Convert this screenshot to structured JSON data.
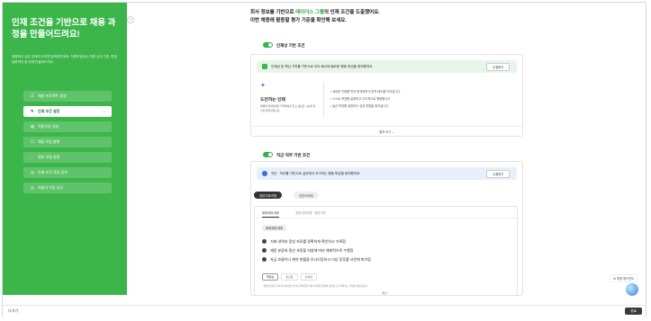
{
  "sidebar": {
    "title": "인재 조건을 기반으로 채용 과정을 만들어드려요!",
    "description": "채용하고 싶은 인재의 조건만 정의해주세요. 직원모집이나 지원 심사 기준, 면접 질문까지 한 번에 만들어드려요.",
    "collapse_label": "‹",
    "items": [
      {
        "label": "채용 프로젝트 생성",
        "icon": "☰"
      },
      {
        "label": "인재 조건 설정",
        "icon": "✎",
        "more": "···"
      },
      {
        "label": "직원모집 생성",
        "icon": "▤"
      },
      {
        "label": "채용 모집 발행",
        "icon": "☐"
      },
      {
        "label": "정보 모집 설정",
        "icon": "◌"
      },
      {
        "label": "인재 조건 작동 검사",
        "icon": "◎"
      },
      {
        "label": "지원서 작동 검사",
        "icon": "◎"
      }
    ]
  },
  "main": {
    "headline_pre": "회사 정보를 기반으로 ",
    "headline_highlight": "레이더스 그룹",
    "headline_post": "의 인재 조건을 도출했어요.",
    "headline_line2": "이번 채용에 활용할 평가 기준을 확인해 보세요.",
    "section1": {
      "label": "인재상 기반 조건",
      "banner_text": "인재상 및 핵심 가치를 기반으로 우리 회사에 필요한 행동 특성을 정의했어요.",
      "banner_button": "수정하기",
      "trait_title": "도전하는 인재",
      "trait_desc": "변화와 불확실성을 두려워하지 않고 새로운 시도와 혁신을 만들어냅니다.",
      "bullets": [
        "새로운 기회를 먼저 탐색하며 도전적 태도를 이어갑니다.",
        "스스로 목표를 설정하고 주도적으로 행동합니다.",
        "높은 목표를 설정하고 성공 방법을 찾아냅니다."
      ],
      "footer": "펼쳐 보기 ⌄"
    },
    "section2": {
      "label": "직군·직무 기반 조건",
      "banner_text": "직군 · 직무를 기반으로 실무에서 요구되는 행동 특성을 정의했어요.",
      "banner_button": "수정하기",
      "pills": [
        "경영기획/지원",
        "영업/마케팅"
      ],
      "subtabs": [
        "회계/재무/세무",
        "경영기획/지원 · 경영 직무"
      ],
      "group_title": "회계/재무/세무",
      "checks": [
        "거래 내역과 증빙 자료를 정확하게 확인하고 기록함",
        "재정 분류와 정산 과정을 지침에 따라 체계적으로 수행함",
        "자금 흐름이나 계약 현황을 모니터링하고 이상 징후를 사전에 파악함"
      ],
      "chips": [
        "책임감",
        "정교함",
        "신뢰성"
      ],
      "note": "· 회계 및 재무 기록의 신뢰성을 높이기 위해 업무 세부 사항을 정확히 점검하고 문서화하는 역량이 필요합니다.",
      "footer": "접기 ⌃"
    }
  },
  "floating": {
    "label": "AI 채용 에이전트"
  },
  "bottom": {
    "prev": "나가기",
    "next": "완료"
  },
  "colors": {
    "accent": "#3cb64b",
    "highlight": "#2ea84f",
    "dark_button": "#3a3a3a"
  }
}
